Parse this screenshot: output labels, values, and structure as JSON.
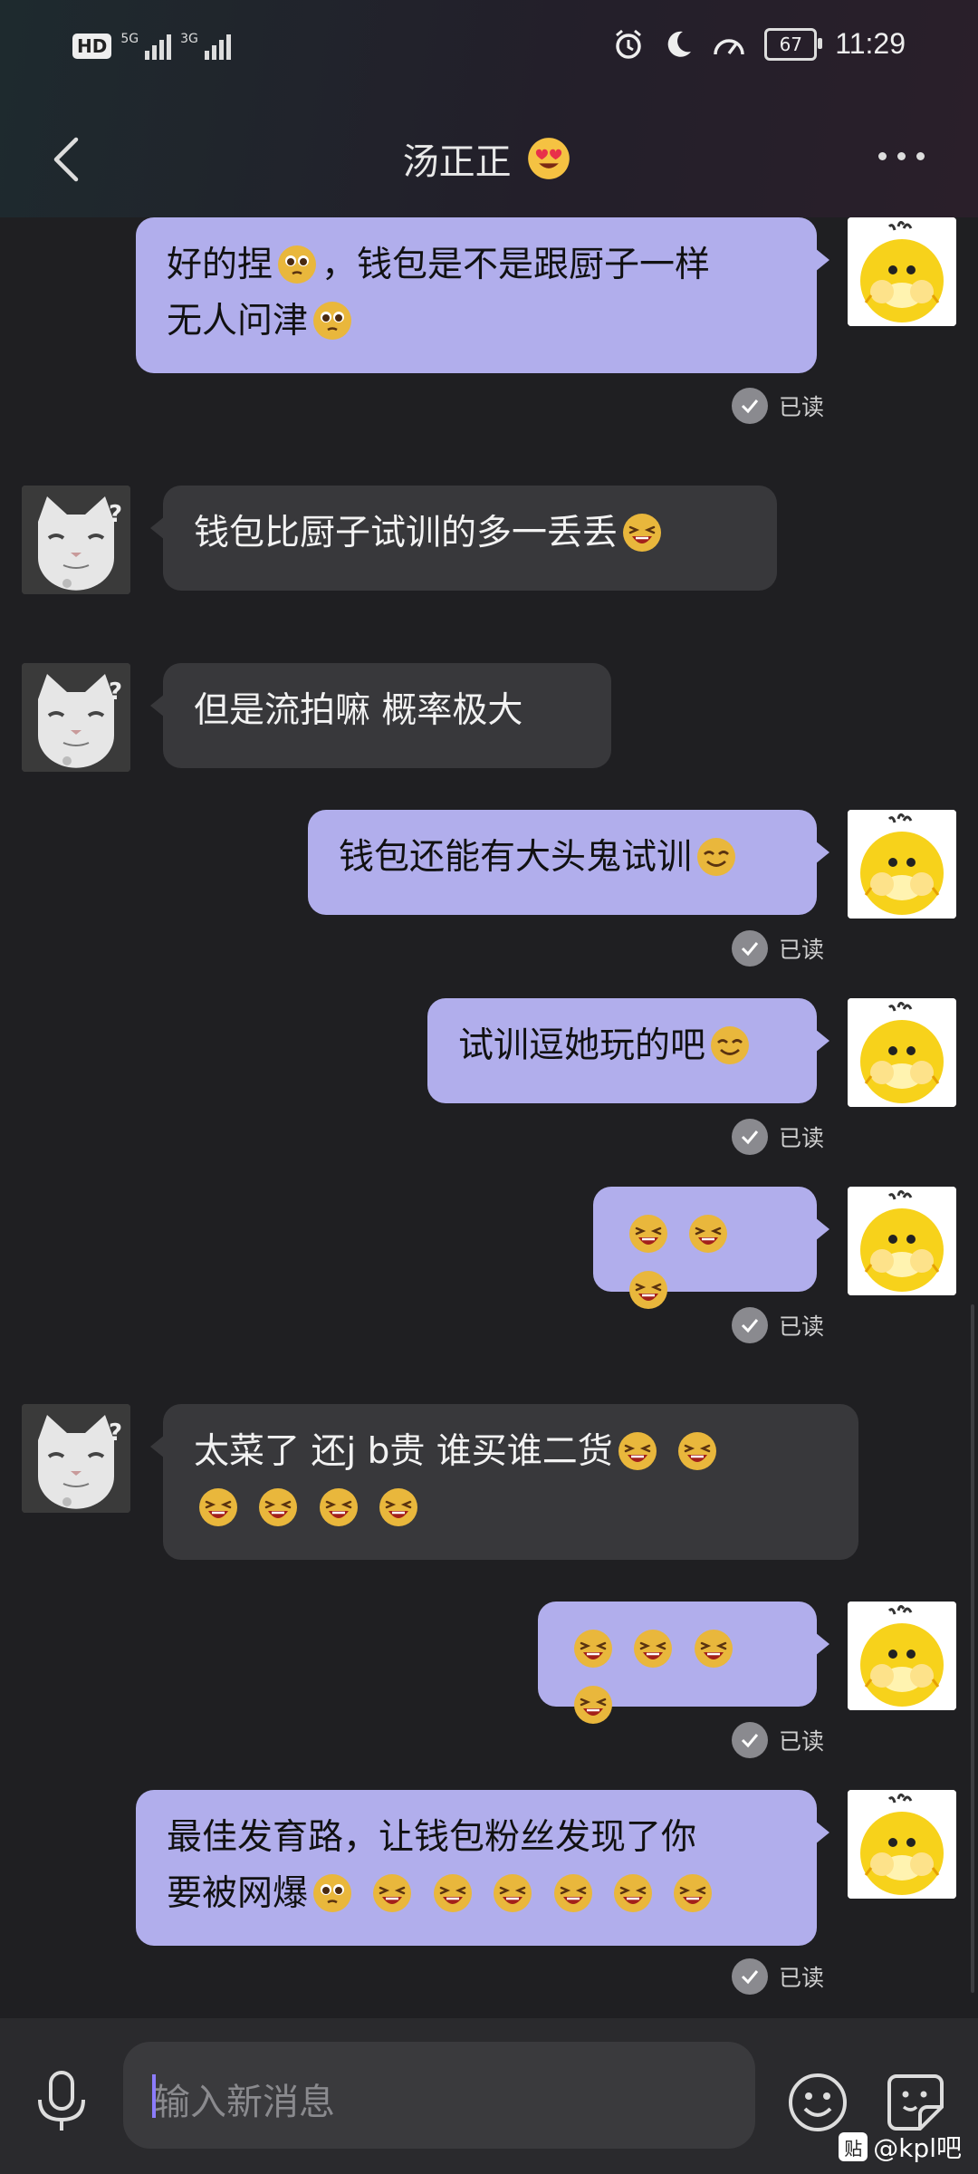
{
  "status_bar": {
    "hd": "HD",
    "sim1": "5G",
    "sim2": "3G",
    "battery": "67",
    "time": "11:29"
  },
  "header": {
    "title": "汤正正"
  },
  "messages": [
    {
      "side": "me",
      "lines": [
        "好的捏[shy]，钱包是不是跟厨子一样",
        "无人问津[shy]"
      ],
      "read": "已读"
    },
    {
      "side": "them",
      "lines": [
        "钱包比厨子试训的多一丢丢[laugh]"
      ]
    },
    {
      "side": "them",
      "lines": [
        "但是流拍嘛 概率极大"
      ]
    },
    {
      "side": "me",
      "lines": [
        "钱包还能有大头鬼试训[smirk]"
      ],
      "read": "已读"
    },
    {
      "side": "me",
      "lines": [
        "试训逗她玩的吧[smirk]"
      ],
      "read": "已读"
    },
    {
      "side": "me",
      "lines": [
        "[laugh] [laugh] [laugh]"
      ],
      "read": "已读"
    },
    {
      "side": "them",
      "lines": [
        "太菜了 还j b贵 谁买谁二货[laugh] [laugh]",
        "[laugh] [laugh] [laugh] [laugh]"
      ]
    },
    {
      "side": "me",
      "lines": [
        "[laugh] [laugh] [laugh] [laugh]"
      ],
      "read": "已读"
    },
    {
      "side": "me",
      "lines": [
        "最佳发育路，让钱包粉丝发现了你",
        "要被网爆[shy] [laugh] [laugh] [laugh] [laugh] [laugh] [laugh]"
      ],
      "read": "已读"
    }
  ],
  "input": {
    "placeholder": "输入新消息"
  },
  "watermark": {
    "badge": "贴",
    "text": "@kpl吧"
  },
  "colors": {
    "my_bubble": "#b1aeec",
    "their_bubble": "#38383b",
    "background": "#1f1f22"
  },
  "icons": [
    "back-icon",
    "more-icon",
    "read-check-icon",
    "mic-icon",
    "smile-icon",
    "sticker-icon"
  ]
}
